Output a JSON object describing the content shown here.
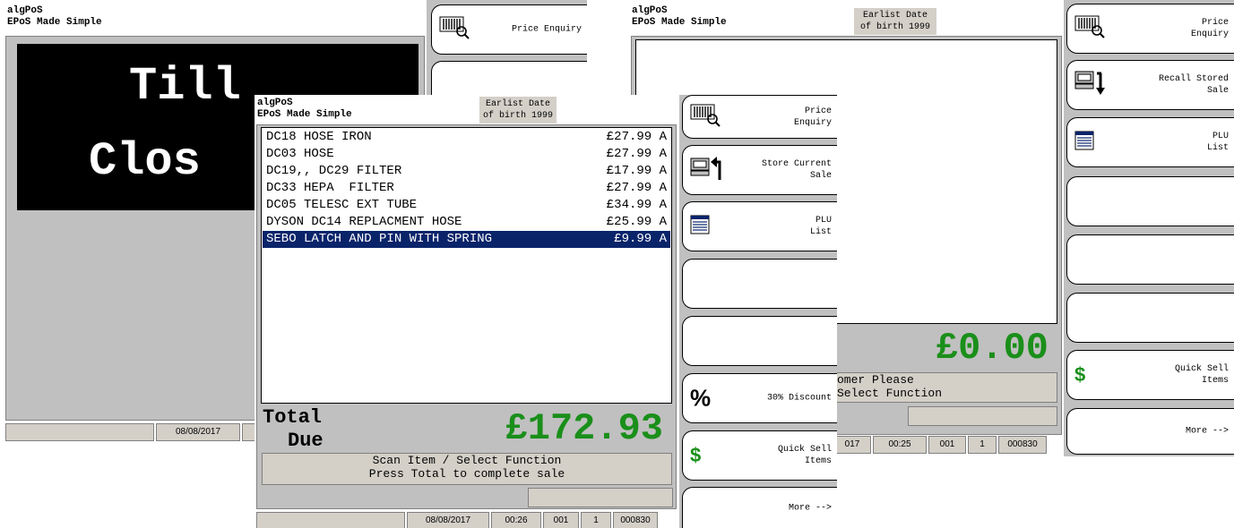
{
  "app": {
    "name": "algPoS",
    "tagline": "EPoS Made Simple"
  },
  "dob_notice": "Earlist Date\nof birth 1999",
  "screen_closed": {
    "line1": "Till",
    "line2": "Clos",
    "status": {
      "date": "08/08/2017"
    },
    "buttons": [
      {
        "label": "Price Enquiry",
        "icon": "barcode-magnifier-icon"
      }
    ]
  },
  "screen_sale": {
    "items": [
      {
        "name": "DC18 HOSE IRON",
        "price": "£27.99 A"
      },
      {
        "name": "DC03 HOSE",
        "price": "£27.99 A"
      },
      {
        "name": "DC19,, DC29 FILTER",
        "price": "£17.99 A"
      },
      {
        "name": "DC33 HEPA  FILTER",
        "price": "£27.99 A"
      },
      {
        "name": "DC05 TELESC EXT TUBE",
        "price": "£34.99 A"
      },
      {
        "name": "DYSON DC14 REPLACMENT HOSE",
        "price": "£25.99 A"
      },
      {
        "name": "SEBO LATCH AND PIN WITH SPRING",
        "price": "£9.99 A",
        "selected": true
      }
    ],
    "total_label_1": "Total",
    "total_label_2": "Due",
    "total_value": "£172.93",
    "message_1": "Scan Item / Select Function",
    "message_2": "Press Total to complete sale",
    "status": {
      "date": "08/08/2017",
      "time": "00:26",
      "till": "001",
      "op": "1",
      "trans": "000830"
    },
    "buttons": [
      {
        "label": "Price\nEnquiry",
        "icon": "barcode-magnifier-icon"
      },
      {
        "label": "Store Current\nSale",
        "icon": "store-sale-icon"
      },
      {
        "label": "PLU\nList",
        "icon": "list-icon"
      },
      {
        "label": ""
      },
      {
        "label": ""
      },
      {
        "label": "30% Discount",
        "icon": "percent-icon"
      },
      {
        "label": "Quick Sell\nItems",
        "icon": "dollar-icon"
      },
      {
        "label": "More -->"
      }
    ]
  },
  "screen_idle": {
    "total_value": "£0.00",
    "message_1": "omer Please",
    "message_2": "Select Function",
    "status": {
      "date_frag": "017",
      "time": "00:25",
      "till": "001",
      "op": "1",
      "trans": "000830"
    },
    "buttons": [
      {
        "label": "Price\nEnquiry",
        "icon": "barcode-magnifier-icon"
      },
      {
        "label": "Recall Stored\nSale",
        "icon": "recall-sale-icon"
      },
      {
        "label": "PLU\nList",
        "icon": "list-icon"
      },
      {
        "label": ""
      },
      {
        "label": ""
      },
      {
        "label": ""
      },
      {
        "label": "Quick Sell\nItems",
        "icon": "dollar-icon"
      },
      {
        "label": "More -->"
      }
    ]
  },
  "colors": {
    "total_green": "#1a8f1a",
    "selection_blue": "#0a246a",
    "panel_grey": "#c0c0c0"
  }
}
